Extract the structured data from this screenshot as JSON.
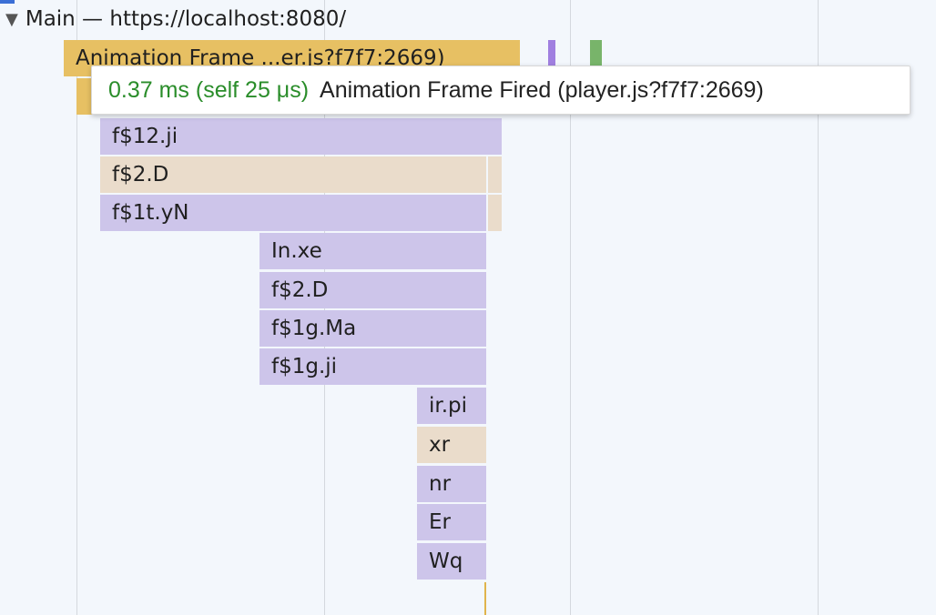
{
  "track": {
    "expand_icon": "triangle-down",
    "title": "Main — https://localhost:8080/"
  },
  "frames": {
    "animation_frame": "Animation Frame ...er.js?f7f7:2669)",
    "f12_ji": "f$12.ji",
    "f2_d": "f$2.D",
    "f1t_yn": "f$1t.yN",
    "in_xe": "In.xe",
    "f2_d_2": "f$2.D",
    "f1g_ma": "f$1g.Ma",
    "f1g_ji": "f$1g.ji",
    "ir_pi": "ir.pi",
    "xr": "xr",
    "nr": "nr",
    "er": "Er",
    "wq": "Wq"
  },
  "tooltip": {
    "duration": "0.37 ms (self 25 μs)",
    "name": "Animation Frame Fired (player.js?f7f7:2669)"
  },
  "colors": {
    "scripting": "#cdc5ea",
    "rendering": "#eadccb",
    "animation": "#e7c063",
    "tooltip_duration": "#2a8d2a"
  }
}
